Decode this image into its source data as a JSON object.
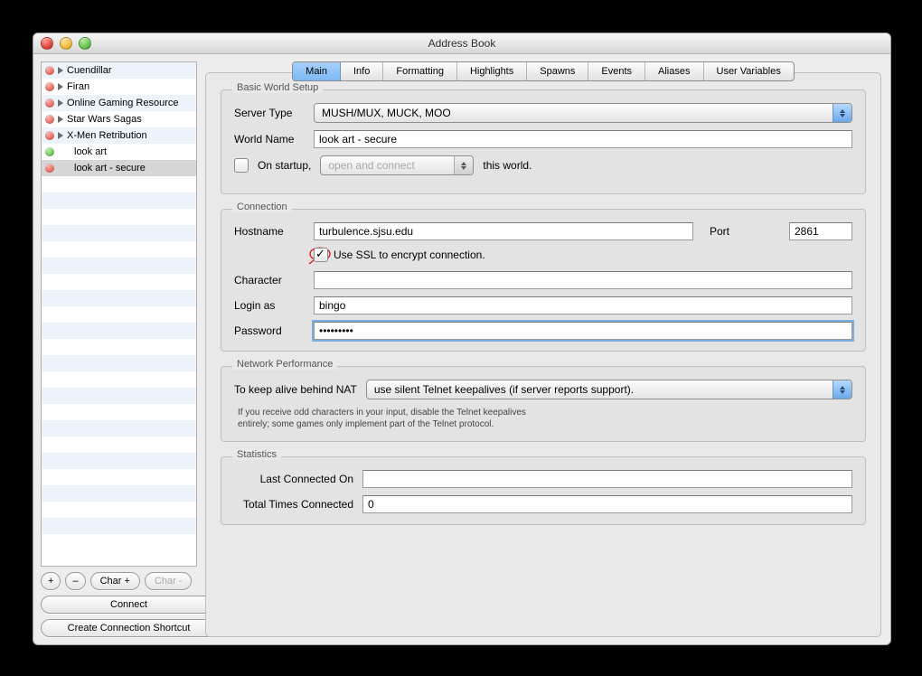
{
  "window": {
    "title": "Address Book"
  },
  "sidebar": {
    "items": [
      {
        "label": "Cuendillar",
        "orb": "red",
        "expandable": true,
        "selected": false
      },
      {
        "label": "Firan",
        "orb": "red",
        "expandable": true,
        "selected": false
      },
      {
        "label": "Online Gaming Resource",
        "orb": "red",
        "expandable": true,
        "selected": false
      },
      {
        "label": "Star Wars Sagas",
        "orb": "red",
        "expandable": true,
        "selected": false
      },
      {
        "label": "X-Men Retribution",
        "orb": "red",
        "expandable": true,
        "selected": false
      },
      {
        "label": "look art",
        "orb": "green",
        "expandable": false,
        "selected": false
      },
      {
        "label": "look art - secure",
        "orb": "red",
        "expandable": false,
        "selected": true
      }
    ],
    "buttons": {
      "add": "+",
      "remove": "–",
      "char_add": "Char +",
      "char_remove": "Char -",
      "connect": "Connect",
      "shortcut": "Create Connection Shortcut"
    }
  },
  "tabs": [
    "Main",
    "Info",
    "Formatting",
    "Highlights",
    "Spawns",
    "Events",
    "Aliases",
    "User Variables"
  ],
  "main": {
    "basic": {
      "legend": "Basic World Setup",
      "server_type_label": "Server Type",
      "server_type_value": "MUSH/MUX, MUCK, MOO",
      "world_name_label": "World Name",
      "world_name_value": "look art - secure",
      "on_startup_label": "On startup,",
      "on_startup_checked": false,
      "startup_action": "open and connect",
      "this_world": "this world."
    },
    "connection": {
      "legend": "Connection",
      "hostname_label": "Hostname",
      "hostname_value": "turbulence.sjsu.edu",
      "port_label": "Port",
      "port_value": "2861",
      "ssl_checked": true,
      "ssl_label": "Use SSL to encrypt connection.",
      "character_label": "Character",
      "character_value": "",
      "login_label": "Login as",
      "login_value": "bingo",
      "password_label": "Password",
      "password_value": "•••••••••"
    },
    "network": {
      "legend": "Network Performance",
      "keepalive_label": "To keep alive behind NAT",
      "keepalive_value": "use silent Telnet keepalives (if server reports support).",
      "hint1": "If you receive odd characters in your input, disable the Telnet keepalives",
      "hint2": "entirely; some games only implement part of the Telnet protocol."
    },
    "stats": {
      "legend": "Statistics",
      "last_label": "Last Connected On",
      "last_value": "",
      "total_label": "Total Times Connected",
      "total_value": "0"
    }
  }
}
